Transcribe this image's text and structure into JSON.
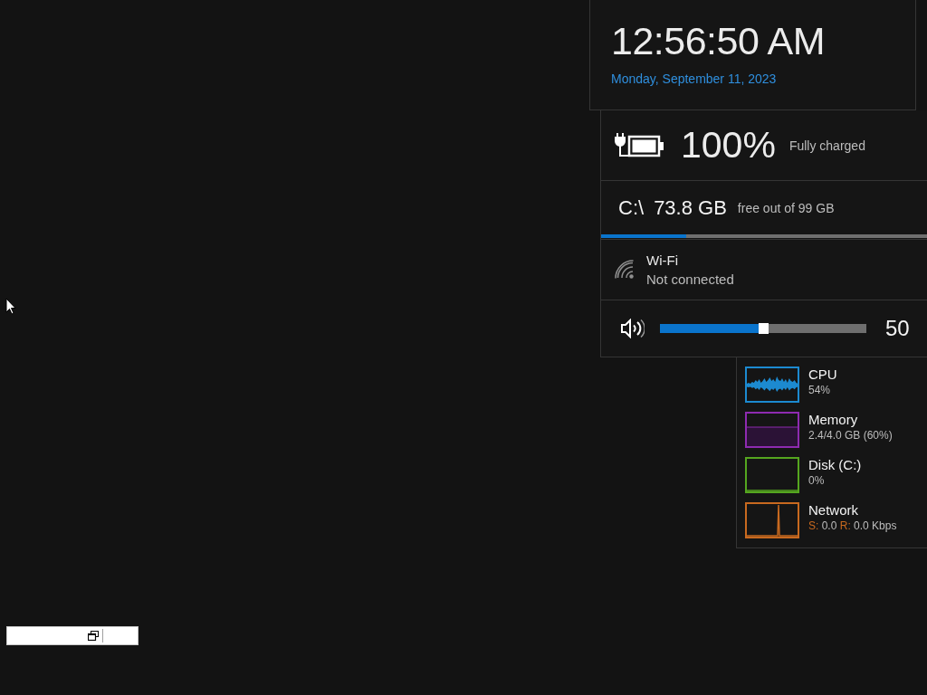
{
  "clock": {
    "time": "12:56:50 AM",
    "date": "Monday, September 11, 2023"
  },
  "battery": {
    "plugged_in": true,
    "percent": "100%",
    "status": "Fully charged"
  },
  "disk": {
    "drive": "C:\\",
    "free": "73.8 GB",
    "detail": "free out of 99 GB",
    "level": 0.26
  },
  "wifi": {
    "connected": false,
    "name": "Wi-Fi",
    "status": "Not connected"
  },
  "volume": {
    "level": 0.5,
    "reading": "50"
  },
  "performance": [
    {
      "kind": "cpu",
      "name": "CPU",
      "reading": "54%",
      "color": "#1c8ad0"
    },
    {
      "kind": "memory",
      "name": "Memory",
      "reading": "2.4/4.0 GB (60%)",
      "color": "#8e2bb0"
    },
    {
      "kind": "disk",
      "name": "Disk (C:)",
      "reading": "0%",
      "color": "#55a61f"
    },
    {
      "kind": "network",
      "name": "Network",
      "reading_parts": [
        {
          "label": "S:",
          "value": "0.0"
        },
        {
          "label": "R:",
          "value": "0.0 Kbps"
        }
      ],
      "color": "#c8691f"
    }
  ]
}
